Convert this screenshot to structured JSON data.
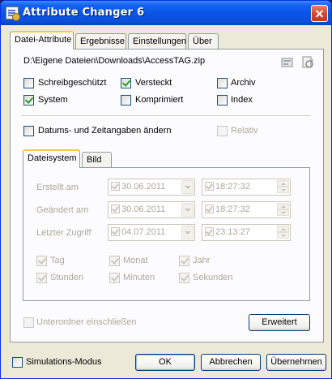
{
  "window": {
    "title": "Attribute Changer 6",
    "icon": "attribute-changer-app-icon"
  },
  "tabs": [
    {
      "label": "Datei-Attribute",
      "active": true
    },
    {
      "label": "Ergebnisse",
      "active": false
    },
    {
      "label": "Einstellungen",
      "active": false
    },
    {
      "label": "Über",
      "active": false
    }
  ],
  "file": {
    "path": "D:\\Eigene Dateien\\Downloads\\AccessTAG.zip",
    "icons": [
      "properties-icon",
      "refresh-icon"
    ]
  },
  "attributes": {
    "read_only": {
      "label": "Schreibgeschützt",
      "checked": false
    },
    "hidden": {
      "label": "Versteckt",
      "checked": true
    },
    "archive": {
      "label": "Archiv",
      "checked": false
    },
    "system": {
      "label": "System",
      "checked": true
    },
    "compressed": {
      "label": "Komprimiert",
      "checked": false
    },
    "index": {
      "label": "Index",
      "checked": false
    }
  },
  "change_dates": {
    "label": "Datums- und Zeitangaben ändern",
    "checked": false
  },
  "relative": {
    "label": "Relativ",
    "checked": false
  },
  "subtabs": [
    {
      "label": "Dateisystem",
      "active": true
    },
    {
      "label": "Bild",
      "active": false
    }
  ],
  "dates": {
    "created": {
      "label": "Erstellt am",
      "date": "30.06.2011",
      "time": "18:27:32"
    },
    "modified": {
      "label": "Geändert am",
      "date": "30.06.2011",
      "time": "18:27:32"
    },
    "accessed": {
      "label": "Letzter Zugriff",
      "date": "04.07.2011",
      "time": "23:13:27"
    }
  },
  "units": {
    "day": "Tag",
    "month": "Monat",
    "year": "Jahr",
    "hours": "Stunden",
    "minutes": "Minuten",
    "seconds": "Sekunden"
  },
  "subfolders": {
    "label": "Unterordner einschließen",
    "checked": false
  },
  "buttons": {
    "advanced": "Erweitert",
    "ok": "OK",
    "cancel": "Abbrechen",
    "apply": "Übernehmen"
  },
  "simulation": {
    "label": "Simulations-Modus",
    "checked": false
  }
}
